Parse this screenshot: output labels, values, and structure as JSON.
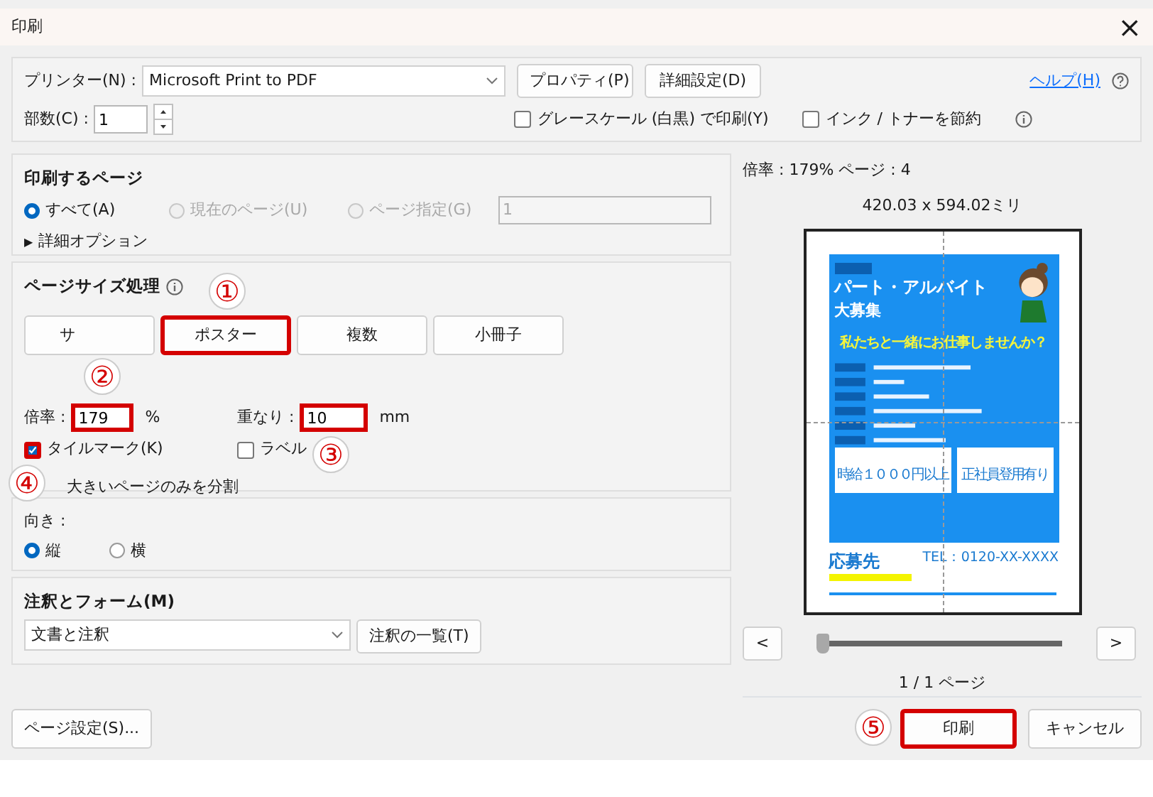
{
  "window": {
    "title": "印刷",
    "close": "×"
  },
  "printer": {
    "label": "プリンター(N) :",
    "value": "Microsoft Print to PDF",
    "buttons": [
      "プロパティ(P)",
      "詳細設定(D)"
    ],
    "help": "ヘルプ(H)"
  },
  "copies": {
    "label": "部数(C) :",
    "value": "1"
  },
  "options": [
    {
      "label": "グレースケール (白黒) で印刷(Y)",
      "checked": false
    },
    {
      "label": "インク / トナーを節約",
      "checked": false
    }
  ],
  "pages": {
    "title": "印刷するページ",
    "radios": [
      {
        "label": "すべて(A)",
        "selected": true,
        "disabled": false
      },
      {
        "label": "現在のページ(U)",
        "selected": false,
        "disabled": true
      },
      {
        "label": "ページ指定(G)",
        "selected": false,
        "disabled": true
      }
    ],
    "range": "1",
    "more_glyph": "▶",
    "more": "詳細オプション"
  },
  "page_size": {
    "title": "ページサイズ処理",
    "modes": [
      {
        "label": "サ",
        "highlighted": false
      },
      {
        "label": "ポスター",
        "highlighted": true
      },
      {
        "label": "複数",
        "highlighted": false
      },
      {
        "label": "小冊子",
        "highlighted": false
      }
    ],
    "fields": [
      {
        "label": "倍率 :",
        "value": "179",
        "unit": "%",
        "highlighted": true
      },
      {
        "label": "重なり :",
        "value": "10",
        "unit": "mm",
        "highlighted": true
      }
    ],
    "checks": [
      {
        "label": "タイルマーク(K)",
        "checked": true,
        "highlighted": true
      },
      {
        "label": "ラベル",
        "checked": false,
        "highlighted": false
      }
    ],
    "split": "大きいページのみを分割"
  },
  "orientation": {
    "title": "向き :",
    "radios": [
      {
        "label": "縦",
        "selected": true
      },
      {
        "label": "横",
        "selected": false
      }
    ]
  },
  "comments": {
    "title": "注釈とフォーム(M)",
    "value": "文書と注釈",
    "button": "注釈の一覧(T)"
  },
  "page_setup": "ページ設定(S)...",
  "preview": {
    "info": "倍率 : 179% ページ : 4",
    "size": "420.03 x 594.02ミリ",
    "poster": {
      "headline": "パート・アルバイト",
      "headline2": "大募集",
      "tagline": "私たちと一緒にお仕事しませんか？",
      "boxes": [
        "時給１０００円以上",
        "正社員登用有り"
      ],
      "apply": "応募先",
      "tel": "TEL：0120-XX-XXXX"
    },
    "prev": "<",
    "next": ">",
    "level": 0,
    "counter": "1 / 1 ページ"
  },
  "actions": [
    {
      "label": "印刷",
      "highlighted": true
    },
    {
      "label": "キャンセル",
      "highlighted": false
    }
  ],
  "annotations": [
    "①",
    "②",
    "③",
    "④",
    "⑤"
  ]
}
